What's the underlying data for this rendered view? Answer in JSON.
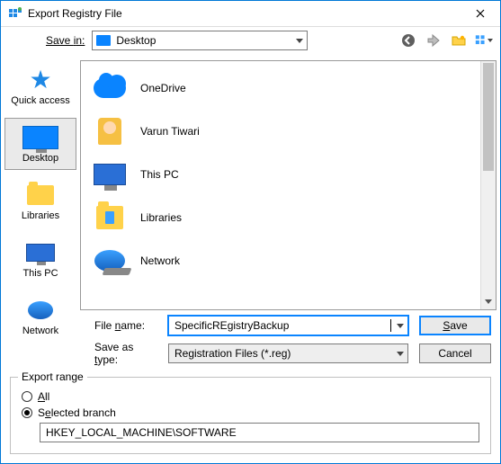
{
  "title": "Export Registry File",
  "toolbar": {
    "save_in_label_pre": "Save ",
    "save_in_label_u": "i",
    "save_in_label_post": "n:",
    "save_in_value": "Desktop",
    "icons": {
      "back": "back-icon",
      "up": "up-one-level-icon",
      "newfolder": "new-folder-icon",
      "viewmenu": "view-menu-icon"
    }
  },
  "places": [
    {
      "name": "quick-access",
      "label": "Quick access"
    },
    {
      "name": "desktop",
      "label": "Desktop",
      "selected": true
    },
    {
      "name": "libraries",
      "label": "Libraries"
    },
    {
      "name": "this-pc",
      "label": "This PC"
    },
    {
      "name": "network",
      "label": "Network"
    }
  ],
  "files": [
    {
      "icon": "onedrive",
      "label": "OneDrive"
    },
    {
      "icon": "user",
      "label": "Varun Tiwari"
    },
    {
      "icon": "pc",
      "label": "This PC"
    },
    {
      "icon": "lib",
      "label": "Libraries"
    },
    {
      "icon": "net",
      "label": "Network"
    }
  ],
  "fields": {
    "file_name_label_pre": "File ",
    "file_name_label_u": "n",
    "file_name_label_post": "ame:",
    "file_name_value": "SpecificREgistryBackup",
    "save_type_label_pre": "Save as ",
    "save_type_label_u": "t",
    "save_type_label_post": "ype:",
    "save_type_value": "Registration Files (*.reg)",
    "save_button_u": "S",
    "save_button_rest": "ave",
    "cancel_button": "Cancel"
  },
  "export": {
    "legend": "Export range",
    "opt_all_u": "A",
    "opt_all_rest": "ll",
    "opt_sel_pre": "S",
    "opt_sel_u": "e",
    "opt_sel_post": "lected branch",
    "branch_value": "HKEY_LOCAL_MACHINE\\SOFTWARE"
  }
}
